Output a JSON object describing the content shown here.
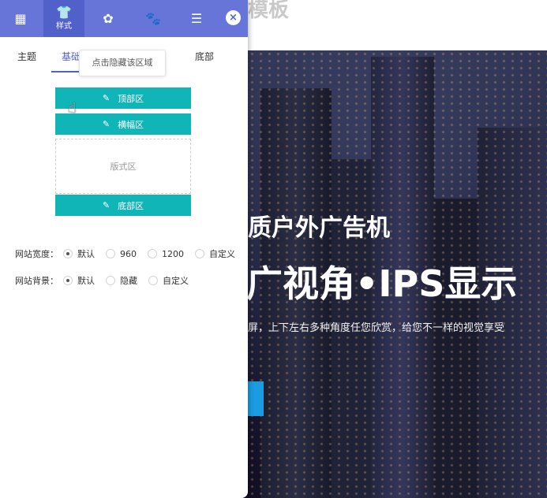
{
  "site": {
    "logo_text": "模板",
    "hero": {
      "title_line1": "质户外广告机",
      "title_line2": "广视角•IPS显示",
      "description": "屏，上下左右多种角度任您欣赏，给您不一样的视觉享受"
    }
  },
  "panel": {
    "tabs": [
      {
        "icon": "grid-icon",
        "glyph": "▦",
        "label": ""
      },
      {
        "icon": "shirt-icon",
        "glyph": "👕",
        "label": "样式"
      },
      {
        "icon": "gear-icon",
        "glyph": "✿",
        "label": ""
      },
      {
        "icon": "paw-icon",
        "glyph": "🐾",
        "label": ""
      },
      {
        "icon": "layers-icon",
        "glyph": "☰",
        "label": ""
      }
    ],
    "close_glyph": "×",
    "subtabs": [
      "主题",
      "基础",
      "底部"
    ],
    "tooltip": "点击隐藏该区域",
    "regions": {
      "top": "顶部区",
      "banner": "横幅区",
      "layout": "版式区",
      "bottom": "底部区"
    },
    "width_option": {
      "label": "网站宽度：",
      "options": [
        "默认",
        "960",
        "1200",
        "自定义"
      ],
      "selected": "默认"
    },
    "background_option": {
      "label": "网站背景：",
      "options": [
        "默认",
        "隐藏",
        "自定义"
      ],
      "selected": "默认"
    }
  },
  "colors": {
    "accent": "#6775d8",
    "accent_dark": "#5261c9",
    "region_teal": "#10b5b8"
  }
}
